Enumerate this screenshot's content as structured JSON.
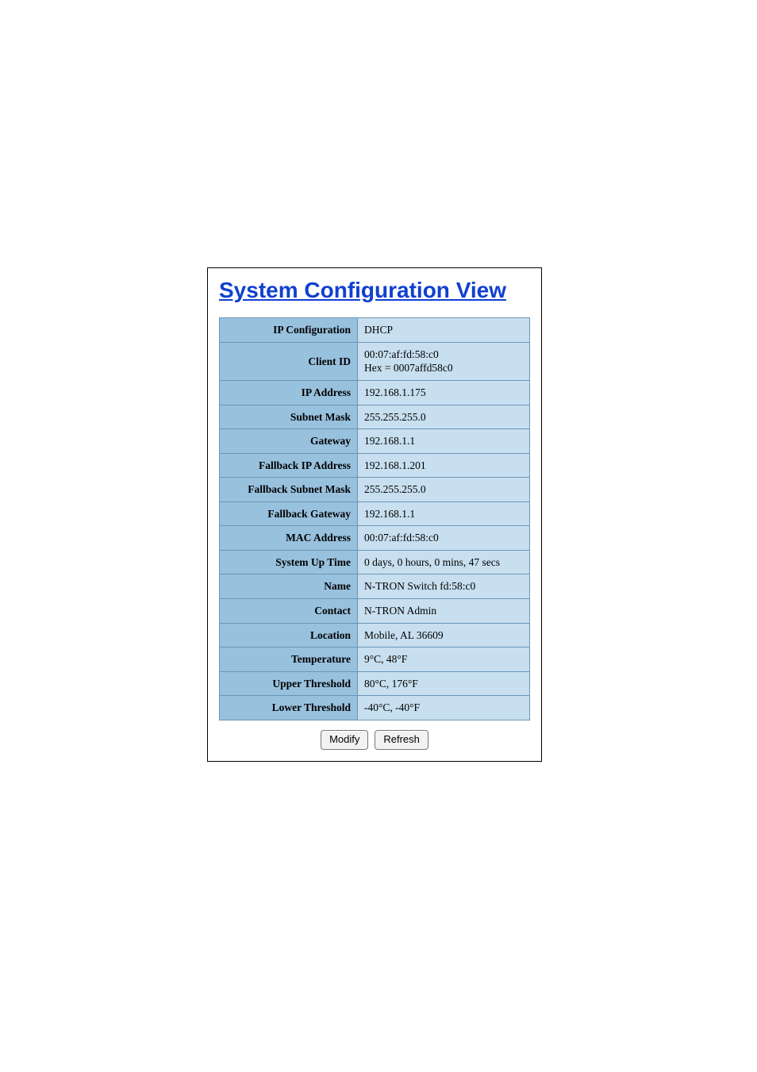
{
  "title": "System Configuration View",
  "rows": [
    {
      "label": "IP Configuration",
      "value": "DHCP"
    },
    {
      "label": "Client ID",
      "value": "00:07:af:fd:58:c0\nHex = 0007affd58c0"
    },
    {
      "label": "IP Address",
      "value": "192.168.1.175"
    },
    {
      "label": "Subnet Mask",
      "value": "255.255.255.0"
    },
    {
      "label": "Gateway",
      "value": "192.168.1.1"
    },
    {
      "label": "Fallback IP Address",
      "value": "192.168.1.201"
    },
    {
      "label": "Fallback Subnet Mask",
      "value": "255.255.255.0"
    },
    {
      "label": "Fallback Gateway",
      "value": "192.168.1.1"
    },
    {
      "label": "MAC Address",
      "value": "00:07:af:fd:58:c0"
    },
    {
      "label": "System Up Time",
      "value": "0 days, 0 hours, 0 mins, 47 secs"
    },
    {
      "label": "Name",
      "value": "N-TRON Switch fd:58:c0"
    },
    {
      "label": "Contact",
      "value": "N-TRON Admin"
    },
    {
      "label": "Location",
      "value": "Mobile, AL 36609"
    },
    {
      "label": "Temperature",
      "value": "9°C, 48°F"
    },
    {
      "label": "Upper Threshold",
      "value": "80°C, 176°F"
    },
    {
      "label": "Lower Threshold",
      "value": "-40°C, -40°F"
    }
  ],
  "buttons": {
    "modify": "Modify",
    "refresh": "Refresh"
  }
}
